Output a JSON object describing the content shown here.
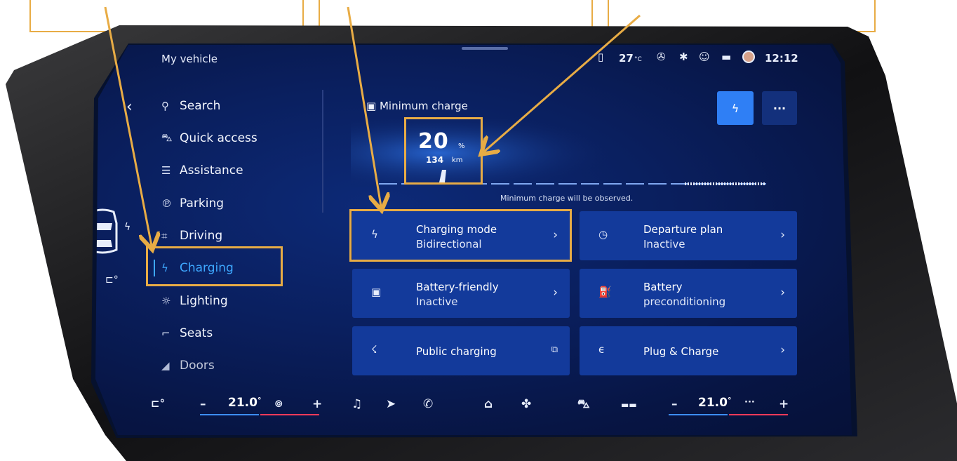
{
  "statusbar": {
    "temperature": "27",
    "temperature_unit": "°C",
    "time": "12:12",
    "icons": [
      "phone-charging-icon",
      "fan-off-icon",
      "bluetooth-icon",
      "people-icon",
      "battery-icon",
      "avatar"
    ]
  },
  "header": {
    "title": "My vehicle"
  },
  "nav": {
    "items": [
      {
        "label": "Search",
        "icon": "search-icon"
      },
      {
        "label": "Quick access",
        "icon": "car-icon"
      },
      {
        "label": "Assistance",
        "icon": "assistance-icon"
      },
      {
        "label": "Parking",
        "icon": "parking-icon"
      },
      {
        "label": "Driving",
        "icon": "driving-icon"
      },
      {
        "label": "Charging",
        "icon": "charging-icon",
        "active": true
      },
      {
        "label": "Lighting",
        "icon": "sun-icon"
      },
      {
        "label": "Seats",
        "icon": "seat-icon"
      },
      {
        "label": "Doors",
        "icon": "door-icon"
      }
    ]
  },
  "charge": {
    "label": "Minimum charge",
    "percent": "20",
    "percent_unit": "%",
    "range": "134",
    "range_unit": "km",
    "note": "Minimum charge will be observed."
  },
  "tiles": [
    {
      "title": "Charging mode",
      "subtitle": "Bidirectional",
      "icon": "charging-mode-icon",
      "trail": "chevron-right-icon"
    },
    {
      "title": "Departure plan",
      "subtitle": "Inactive",
      "icon": "clock-icon",
      "trail": "chevron-right-icon"
    },
    {
      "title": "Battery-friendly",
      "subtitle": "Inactive",
      "icon": "battery-friendly-icon",
      "trail": "chevron-right-icon"
    },
    {
      "title": "Battery",
      "subtitle": "preconditioning",
      "icon": "battery-precondition-icon",
      "trail": "chevron-right-icon"
    },
    {
      "title": "Public charging",
      "subtitle": "",
      "icon": "public-charging-icon",
      "trail": "external-link-icon"
    },
    {
      "title": "Plug & Charge",
      "subtitle": "",
      "icon": "plug-charge-icon",
      "trail": "chevron-right-icon"
    }
  ],
  "climate": {
    "left_temp": "21.0",
    "right_temp": "21.0",
    "degree": "°",
    "minus": "–",
    "plus": "+"
  },
  "colors": {
    "accent": "#3ea8ff",
    "callout": "#e8ac45",
    "tile": "#133a9b",
    "screen": "#0a1f5e"
  }
}
